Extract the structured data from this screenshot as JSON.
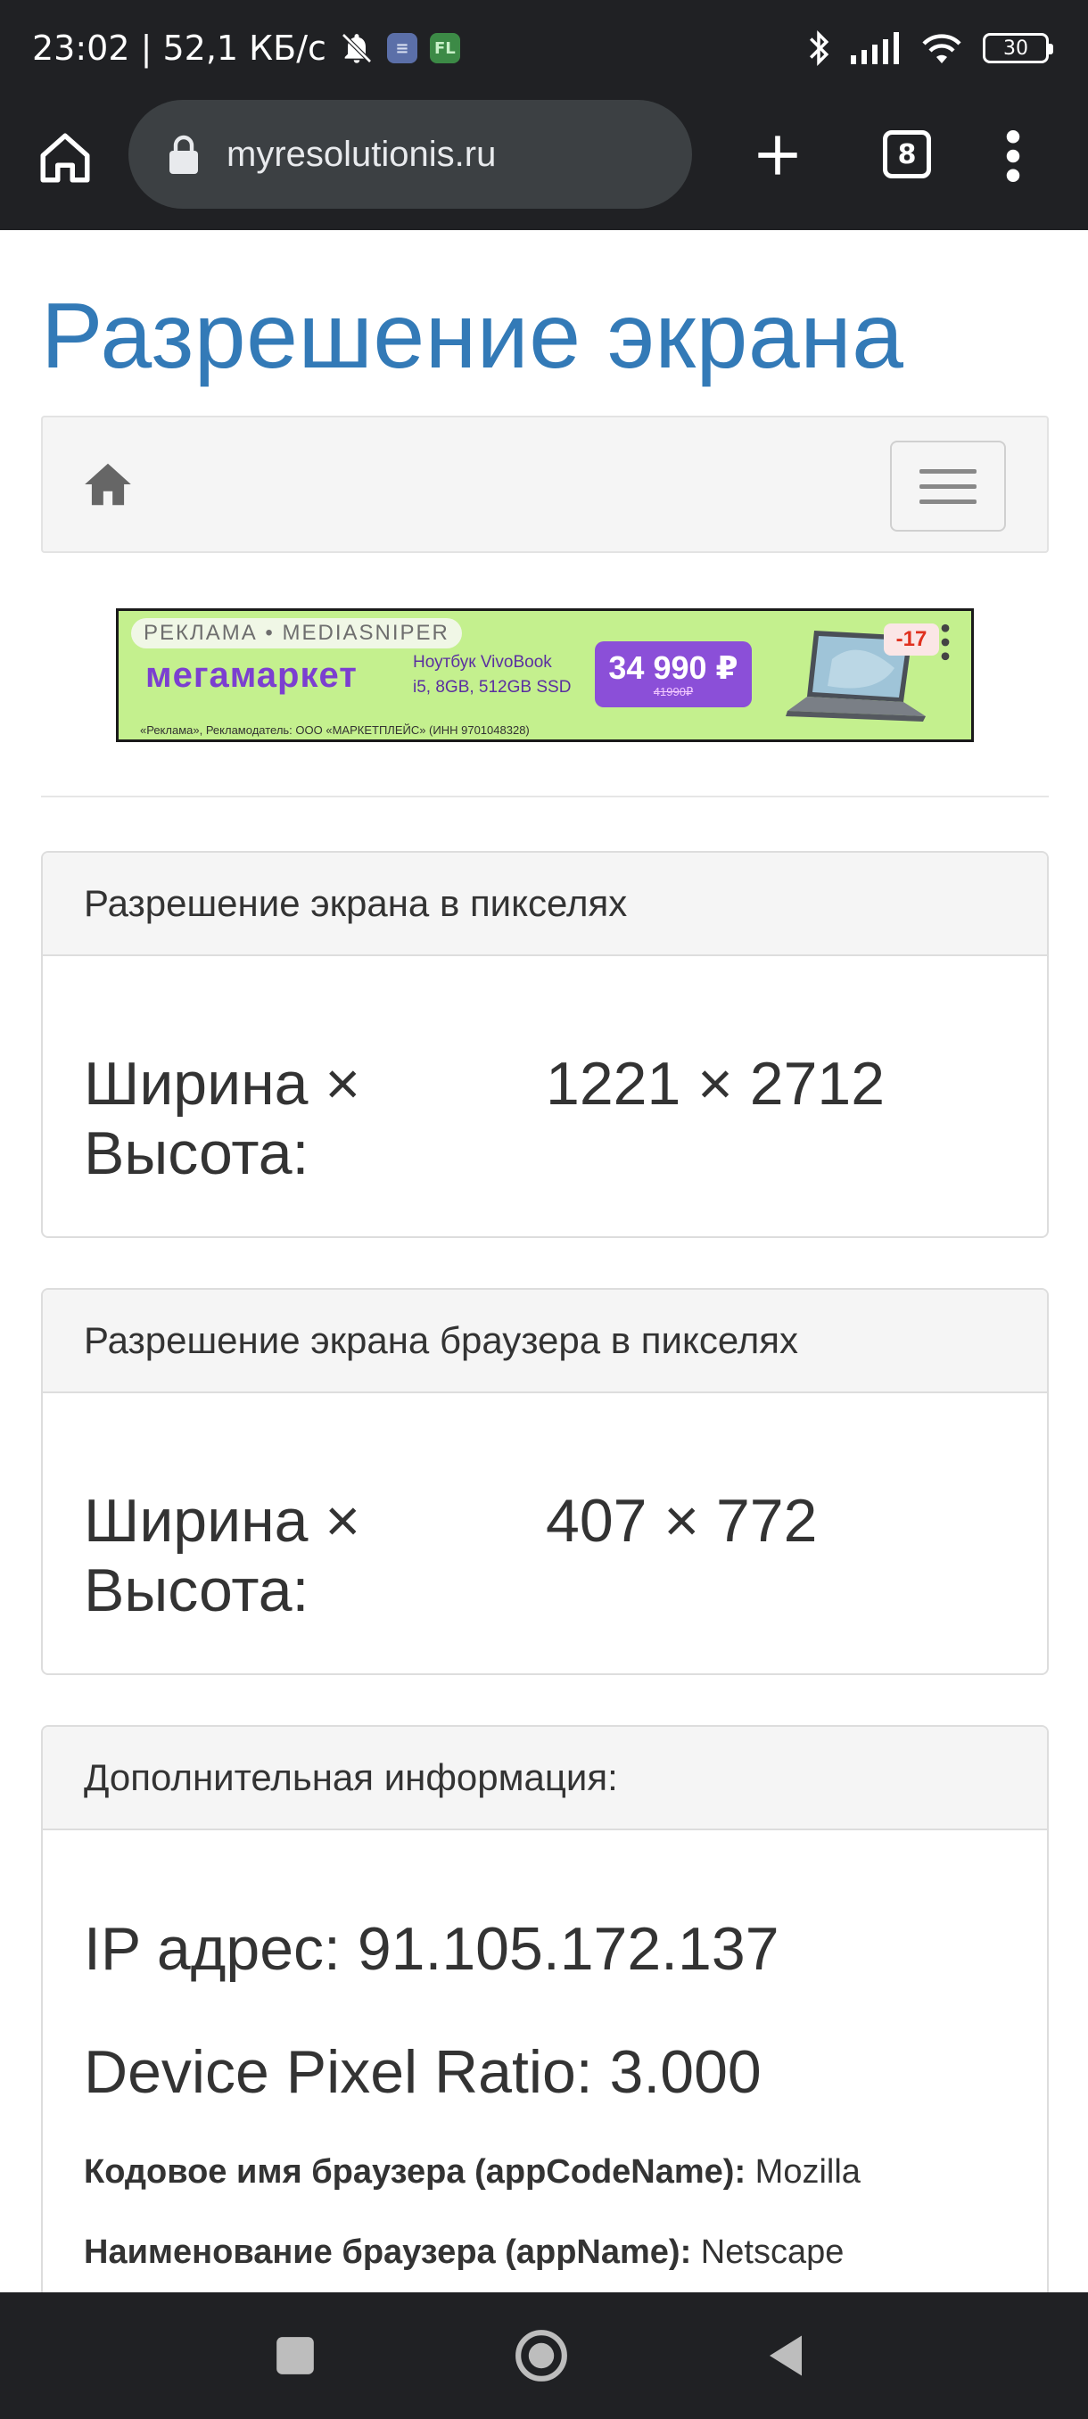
{
  "status_bar": {
    "time_and_speed": "23:02 | 52,1 КБ/с",
    "battery_level": "30",
    "icons": [
      "mute-icon",
      "notes-app-icon",
      "fl-app-icon",
      "bluetooth-icon",
      "signal-icon",
      "wifi-icon",
      "battery-icon"
    ],
    "fl_label": "FL"
  },
  "browser": {
    "url": "myresolutionis.ru",
    "tab_count": "8"
  },
  "site": {
    "title": "Разрешение экрана"
  },
  "ad": {
    "label": "РЕКЛАМА • MEDIASNIPER",
    "brand": "мегамаркет",
    "product_line1": "Ноутбук VivoBook",
    "product_line2": "i5, 8GB, 512GB SSD",
    "price": "34 990 ₽",
    "old_price": "41990₽",
    "discount": "-17",
    "legal": "«Реклама», Рекламодатель: ООО «МАРКЕТПЛЕЙС» (ИНН 9701048328)",
    "colors": {
      "background": "#c4f08e",
      "brand": "#7b3fd0",
      "price_bg": "#8b4fd8"
    }
  },
  "panels": {
    "screen": {
      "heading": "Разрешение экрана в пикселях",
      "label": "Ширина × Высота:",
      "value": "1221 × 2712"
    },
    "browser": {
      "heading": "Разрешение экрана браузера в пикселях",
      "label": "Ширина × Высота:",
      "value": "407 × 772"
    },
    "extra": {
      "heading": "Дополнительная информация:",
      "ip": "IP адрес: 91.105.172.137",
      "dpr": "Device Pixel Ratio: 3.000",
      "app_code_name_label": "Кодовое имя браузера (appCodeName):",
      "app_code_name_value": " Mozilla",
      "app_name_label": "Наименование браузера (appName):",
      "app_name_value": " Netscape"
    }
  },
  "theme": {
    "title_color": "#337ab7",
    "chrome_bg": "#202124"
  }
}
